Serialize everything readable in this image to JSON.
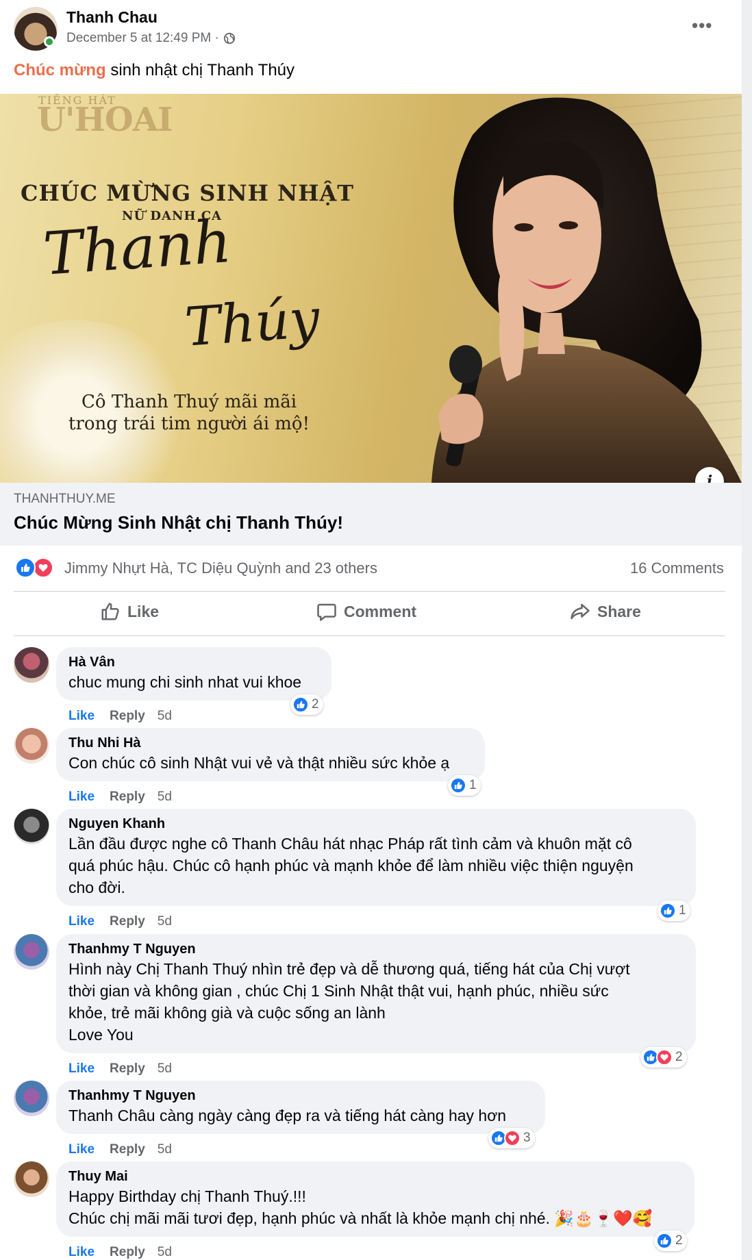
{
  "post": {
    "author": "Thanh Chau",
    "timestamp": "December 5 at 12:49 PM · ",
    "privacy_icon": "globe-icon",
    "text_highlight": "Chúc mừng",
    "text_rest": " sinh nhật chị Thanh Thúy",
    "more_icon": "•••"
  },
  "image": {
    "logo_small": "TIẾNG HÁT",
    "logo": "U'HOAI",
    "title": "CHÚC MỪNG SINH NHẬT",
    "subtitle": "NỮ DANH CA",
    "script_line1": "Thanh",
    "script_line2": "Thúy",
    "caption_line1": "Cô Thanh Thuý mãi mãi",
    "caption_line2": "trong trái tim người ái mộ!",
    "info_icon": "i"
  },
  "link": {
    "domain": "THANHTHUY.ME",
    "title": "Chúc Mừng Sinh Nhật chị Thanh Thúy!"
  },
  "reactions": {
    "names": "Jimmy Nhựt Hà, TC Diệu Quỳnh and 23 others",
    "comments": "16 Comments"
  },
  "actions": {
    "like": "Like",
    "comment": "Comment",
    "share": "Share"
  },
  "comment_actions": {
    "like": "Like",
    "reply": "Reply"
  },
  "comments": [
    {
      "name": "Hà Vân",
      "text": [
        "chuc mung chi sinh nhat vui khoe"
      ],
      "time": "5d",
      "react_count": "2",
      "react_types": [
        "like"
      ]
    },
    {
      "name": "Thu Nhi Hà",
      "text": [
        "Con chúc cô sinh Nhật vui vẻ và thật nhiều sức khỏe ạ"
      ],
      "time": "5d",
      "react_count": "1",
      "react_types": [
        "like"
      ]
    },
    {
      "name": "Nguyen Khanh",
      "text": [
        "Lần đầu được nghe cô Thanh Châu hát nhạc Pháp rất tình cảm và khuôn mặt cô",
        "quá phúc hậu. Chúc cô hạnh phúc và mạnh khỏe để làm nhiều việc thiện nguyện",
        "cho đời."
      ],
      "time": "5d",
      "react_count": "1",
      "react_types": [
        "like"
      ]
    },
    {
      "name": "Thanhmy T Nguyen",
      "text": [
        "Hình này Chị Thanh Thuý nhìn trẻ đẹp và dễ thương quá, tiếng hát của Chị vượt",
        "thời gian và không gian , chúc Chị 1 Sinh Nhật thật vui, hạnh phúc, nhiều sức",
        "khỏe, trẻ mãi không già và cuộc sống an lành",
        "Love You"
      ],
      "time": "5d",
      "react_count": "2",
      "react_types": [
        "like",
        "love"
      ]
    },
    {
      "name": "Thanhmy T Nguyen",
      "text": [
        "Thanh Châu càng ngày càng đẹp ra và tiếng hát càng hay hơn"
      ],
      "time": "5d",
      "react_count": "3",
      "react_types": [
        "like",
        "love"
      ]
    },
    {
      "name": "Thuy Mai",
      "text": [
        "Happy Birthday chị Thanh Thuý.!!!",
        "Chúc chị mãi mãi tươi đẹp, hạnh phúc và nhất là khỏe mạnh chị nhé. 🎉🎂🍷❤️🥰"
      ],
      "time": "5d",
      "react_count": "2",
      "react_types": [
        "like"
      ]
    }
  ],
  "colors": {
    "accent": "#1877f2",
    "highlight": "#e9704c",
    "secondary_text": "#65676b",
    "bubble": "#f0f2f5",
    "love": "#f33e58"
  }
}
